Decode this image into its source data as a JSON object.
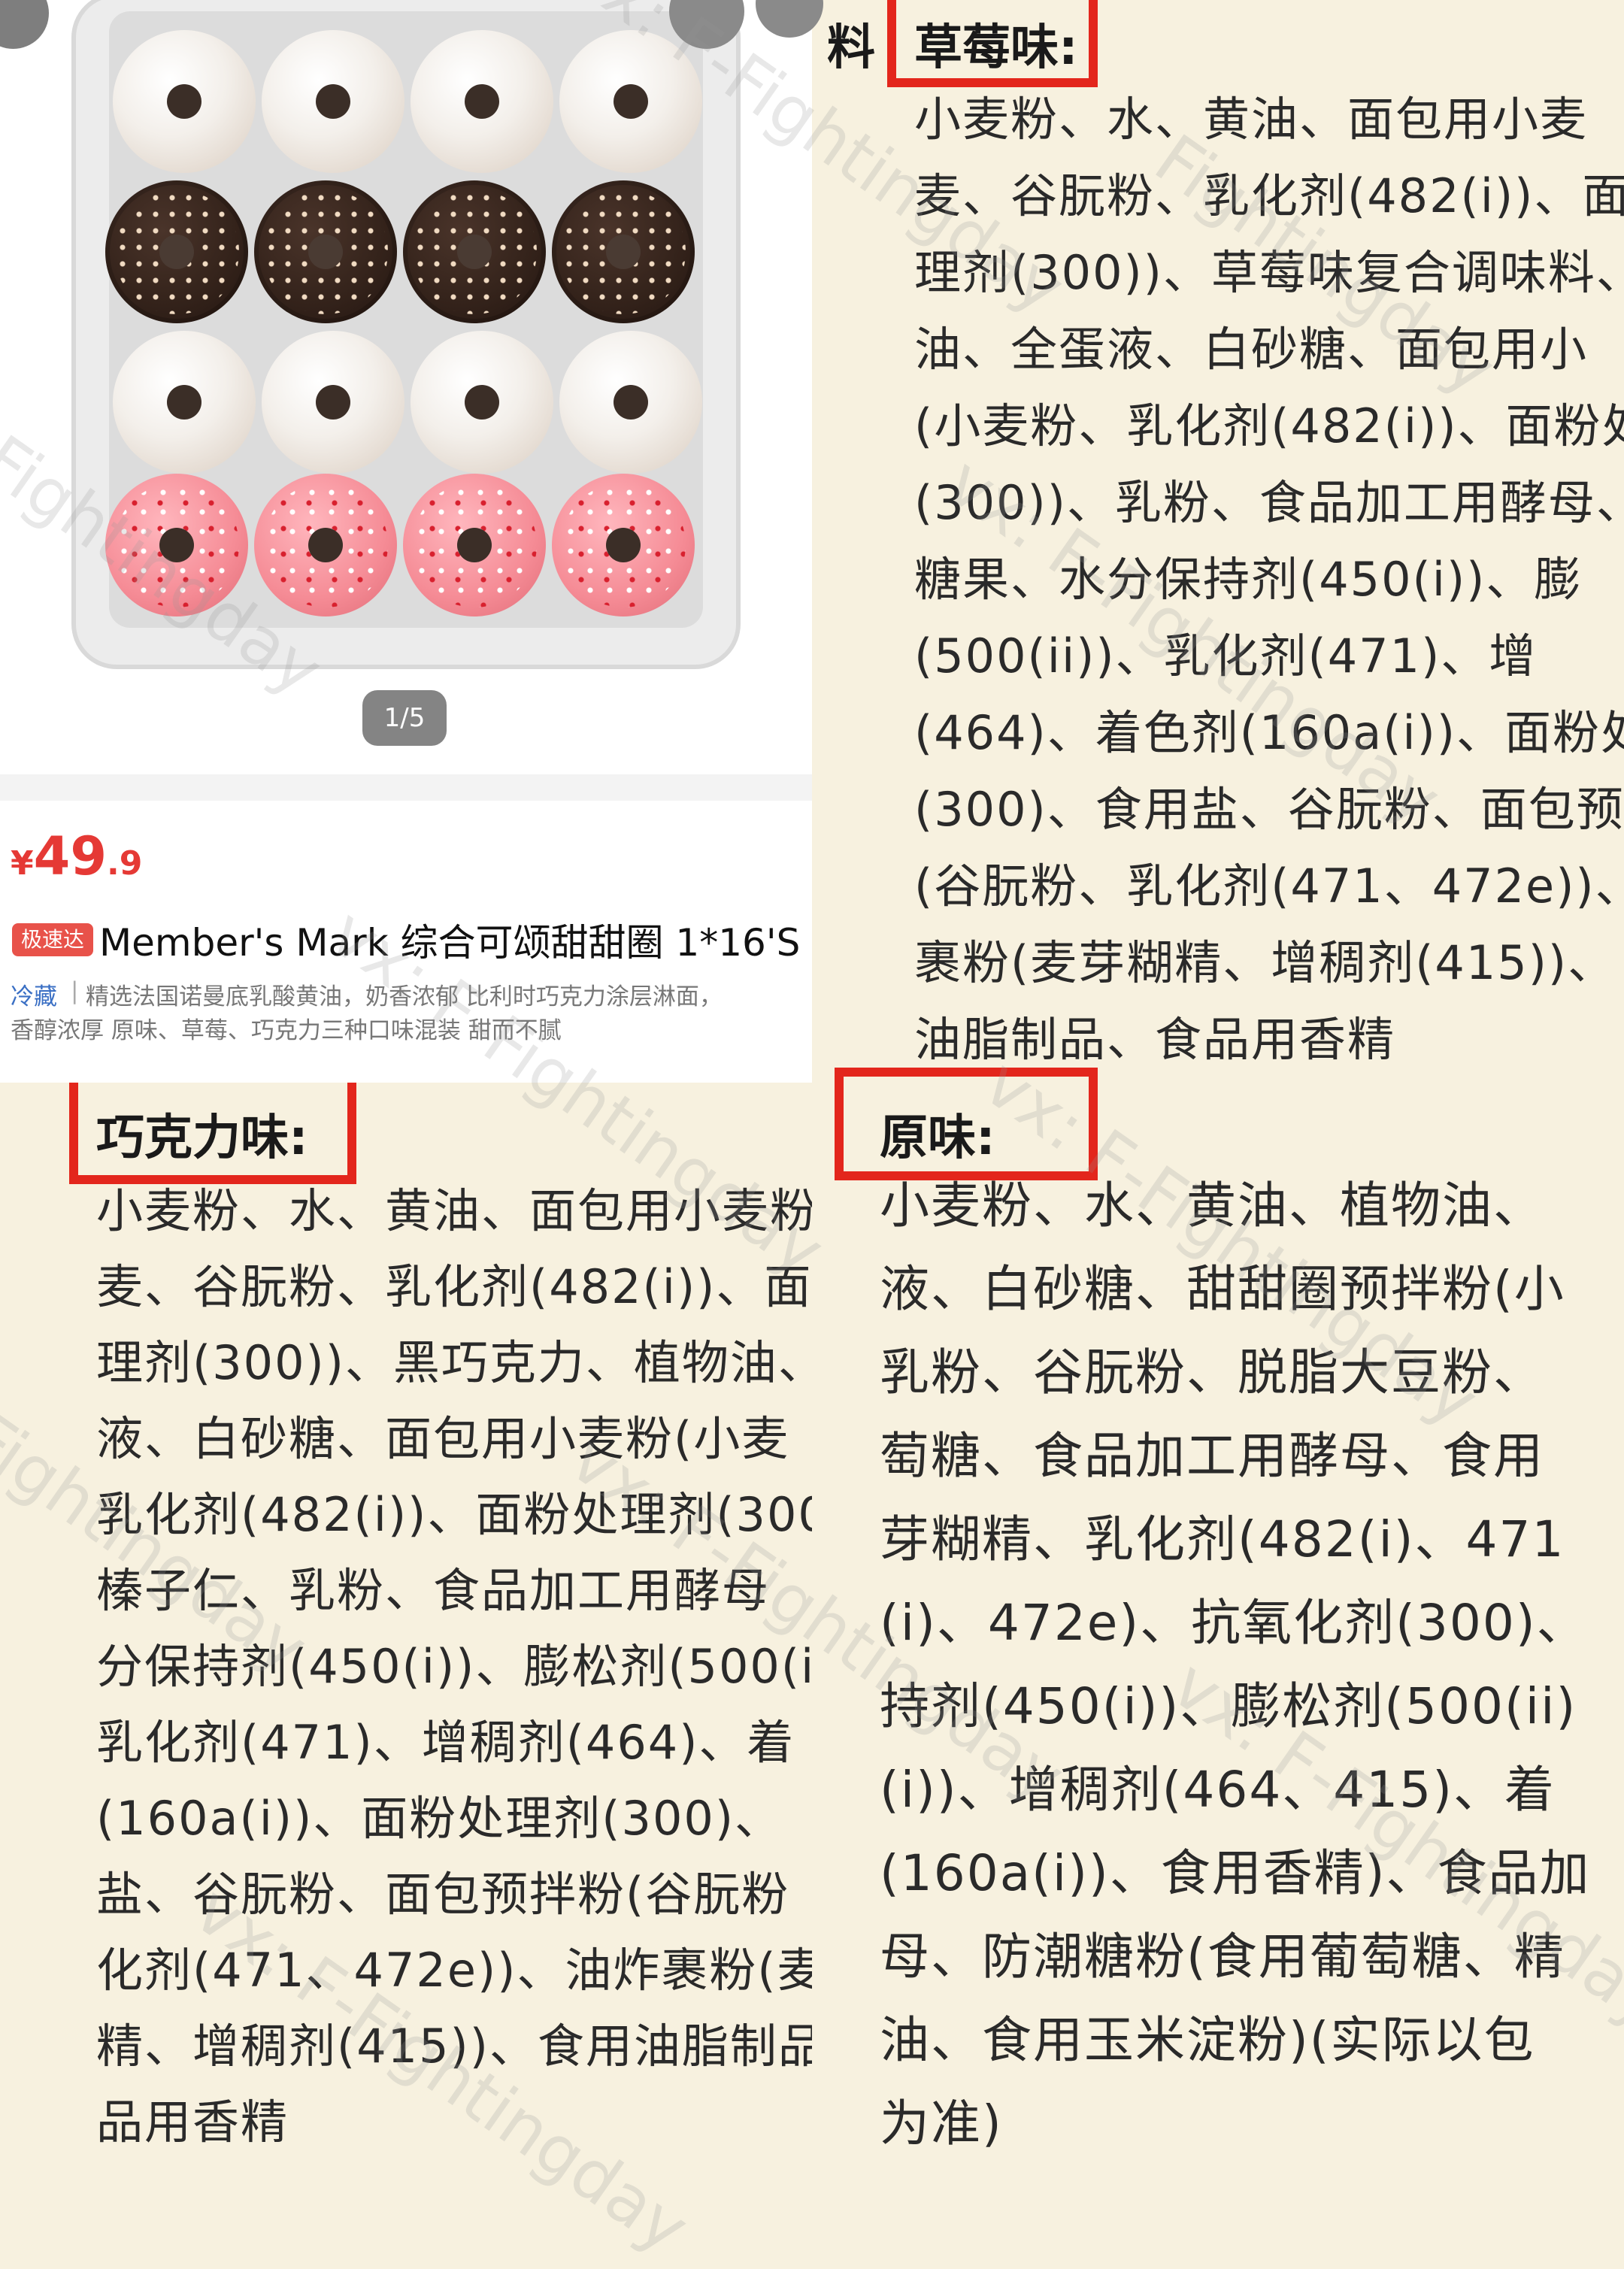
{
  "product": {
    "image_pager": "1/5",
    "price": {
      "currency": "¥",
      "integer": "49",
      "decimal": ".9"
    },
    "badge": "极速达",
    "title": "Member's Mark 综合可颂甜甜圈 1*16'S",
    "tag": "冷藏",
    "separator": "|",
    "description_line1": "精选法国诺曼底乳酸黄油，奶香浓郁 比利时巧克力涂层淋面，",
    "description_line2": "香醇浓厚 原味、草莓、巧克力三种口味混装 甜而不腻"
  },
  "strawberry": {
    "prefix": "料",
    "heading": "草莓味:",
    "lines": [
      "小麦粉、水、黄油、面包用小麦",
      "麦、谷朊粉、乳化剂(482(i))、面",
      "理剂(300))、草莓味复合调味料、",
      "油、全蛋液、白砂糖、面包用小",
      "(小麦粉、乳化剂(482(i))、面粉处",
      "(300))、乳粉、食品加工用酵母、",
      "糖果、水分保持剂(450(i))、膨",
      "(500(ii))、乳化剂(471)、增",
      "(464)、着色剂(160a(i))、面粉处",
      "(300)、食用盐、谷朊粉、面包预",
      "(谷朊粉、乳化剂(471、472e))、",
      "裹粉(麦芽糊精、增稠剂(415))、",
      "油脂制品、食品用香精"
    ]
  },
  "chocolate": {
    "heading": "巧克力味:",
    "lines": [
      "小麦粉、水、黄油、面包用小麦粉",
      "麦、谷朊粉、乳化剂(482(i))、面",
      "理剂(300))、黑巧克力、植物油、",
      "液、白砂糖、面包用小麦粉(小麦",
      "乳化剂(482(i))、面粉处理剂(300",
      "榛子仁、乳粉、食品加工用酵母",
      "分保持剂(450(i))、膨松剂(500(i",
      "乳化剂(471)、增稠剂(464)、着",
      "(160a(i))、面粉处理剂(300)、",
      "盐、谷朊粉、面包预拌粉(谷朊粉",
      "化剂(471、472e))、油炸裹粉(麦",
      "精、增稠剂(415))、食用油脂制品",
      "品用香精"
    ]
  },
  "original": {
    "heading": "原味:",
    "lines": [
      "小麦粉、水、黄油、植物油、",
      "液、白砂糖、甜甜圈预拌粉(小",
      "乳粉、谷朊粉、脱脂大豆粉、",
      "萄糖、食品加工用酵母、食用",
      "芽糊精、乳化剂(482(i)、471",
      "(i)、472e)、抗氧化剂(300)、",
      "持剂(450(i))、膨松剂(500(ii)",
      "(i))、增稠剂(464、415)、着",
      "(160a(i))、食用香精)、食品加",
      "母、防潮糖粉(食用葡萄糖、精",
      "油、食用玉米淀粉)(实际以包",
      "为准)"
    ]
  },
  "watermark": {
    "text_a": "vx: F-Fightingday",
    "text_b": "Fightingday"
  },
  "colors": {
    "price_red": "#e53935",
    "highlight_box": "#e3261c",
    "badge_bg": "#e8524a",
    "cold_tag": "#3a6fc4",
    "page_bg": "#f7f1df"
  }
}
